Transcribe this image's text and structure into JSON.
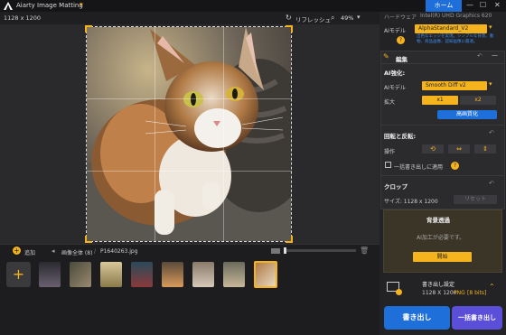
{
  "app": {
    "title": "Aiarty Image Matting",
    "home_label": "ホーム"
  },
  "window_controls": {
    "minimize": "—",
    "maximize": "☐",
    "close": "✕"
  },
  "toolbar": {
    "dimensions": "1128 x 1200",
    "refresh_label": "リフレッシュ",
    "zoom": "49%"
  },
  "right_panel": {
    "top_line": "ハードウェア",
    "top_line_value": "Intel(R) UHD Graphics 620",
    "ai_model_label": "AIモデル",
    "ai_model_value": "AlphaStandard_V2",
    "ai_model_hint": "出色なエッジを実現。シンプルな背景、動物、商品画像、認知画像に最適。",
    "edit_title": "編集",
    "ai_enhance_title": "AI強化:",
    "enhance_model_label": "AIモデル",
    "enhance_model_value": "Smooth Diff v2",
    "scale_label": "拡大",
    "scale_x1": "x1",
    "scale_x2": "x2",
    "hq_button": "高画質化",
    "rotate_title": "回転と反転:",
    "operation_label": "操作",
    "batch_apply_label": "一括書き出しに適用",
    "crop_title": "クロップ",
    "size_label": "サイズ: 1128 x 1200",
    "reset_label": "リセット",
    "bg_title": "背景透過",
    "bg_hint": "AI加工が必要です。",
    "start_button": "開始",
    "export_settings_title": "書き出し設定",
    "export_format": "1128 X 1200",
    "export_ext": "PNG",
    "export_bits": "[8 bits]",
    "export_button": "書き出し",
    "batch_export_button": "一括書き出し"
  },
  "bottom": {
    "add_label": "追加",
    "all_images_label": "画像全体 (8)",
    "filename": "P1640263.jpg",
    "thumbnail_count": 8
  },
  "colors": {
    "accent": "#f5b41e",
    "blue": "#1e6fd9",
    "purple": "#5b4fd9"
  }
}
